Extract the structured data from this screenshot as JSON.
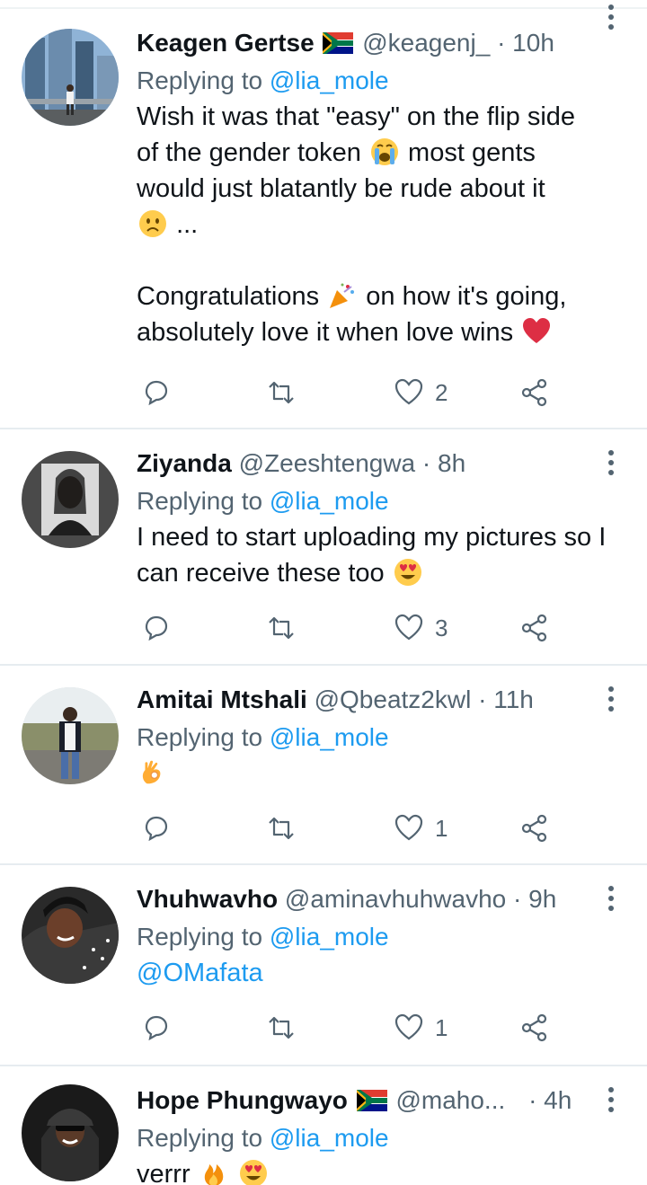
{
  "tweets": [
    {
      "name": "Keagen Gertse",
      "flag": "south-africa-flag",
      "handle": "@keagenj_",
      "dot": "·",
      "time": "10h",
      "replying_prefix": "Replying to ",
      "replying_to": "@lia_mole",
      "body_lines": [
        "Wish it was that \"easy\" on the flip side",
        "of the gender token",
        "most gents",
        "would just blatantly be rude about it",
        "...",
        "Congratulations",
        "on how it's going,",
        "absolutely love it when love wins"
      ],
      "reply_count": "",
      "retweet_count": "",
      "like_count": "2"
    },
    {
      "name": "Ziyanda",
      "handle": "@Zeeshtengwa",
      "dot": "·",
      "time": "8h",
      "replying_prefix": "Replying to ",
      "replying_to": "@lia_mole",
      "body_lines": [
        "I need to start uploading my pictures so I",
        "can receive these too"
      ],
      "like_count": "3"
    },
    {
      "name": "Amitai Mtshali",
      "handle": "@Qbeatz2kwl",
      "dot": "·",
      "time": "11h",
      "replying_prefix": "Replying to ",
      "replying_to": "@lia_mole",
      "like_count": "1"
    },
    {
      "name": "Vhuhwavho",
      "handle": "@aminavhuhwavho",
      "dot": "·",
      "time": "9h",
      "replying_prefix": "Replying to ",
      "replying_to": "@lia_mole",
      "body_mention": "@OMafata",
      "like_count": "1"
    },
    {
      "name": "Hope Phungwayo",
      "flag": "south-africa-flag",
      "handle": "@maho...",
      "dot": "·",
      "time": "4h",
      "replying_prefix": "Replying to ",
      "replying_to": "@lia_mole",
      "body_lines": [
        "verrr"
      ]
    }
  ],
  "colors": {
    "text": "#0f1419",
    "muted": "#536471",
    "link": "#1d9bf0",
    "divider": "#e6ecf0"
  }
}
